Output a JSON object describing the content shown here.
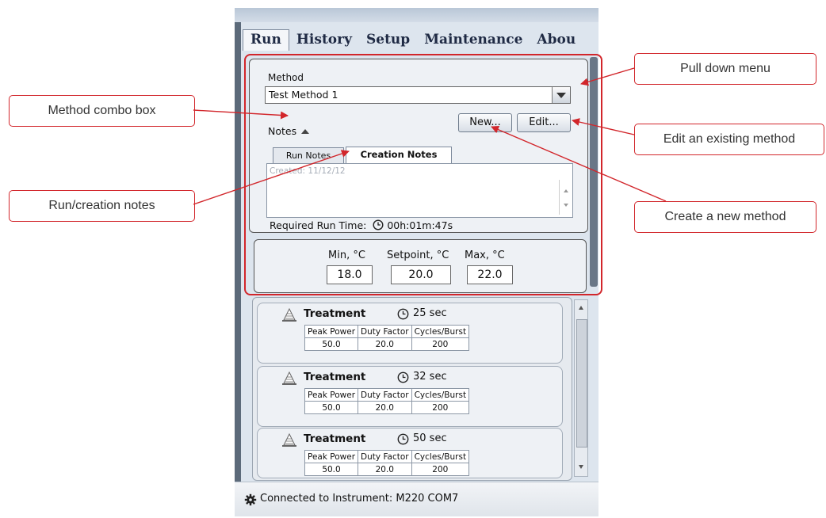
{
  "tabs": [
    {
      "label": "Run",
      "active": true
    },
    {
      "label": "History",
      "active": false
    },
    {
      "label": "Setup",
      "active": false
    },
    {
      "label": "Maintenance",
      "active": false
    },
    {
      "label": "Abou",
      "active": false
    }
  ],
  "method": {
    "label": "Method",
    "selected": "Test Method 1",
    "new_button": "New...",
    "edit_button": "Edit..."
  },
  "notes": {
    "label": "Notes",
    "tabs": [
      {
        "label": "Run Notes",
        "active": false
      },
      {
        "label": "Creation Notes",
        "active": true
      }
    ],
    "content": "Created: 11/12/12"
  },
  "run_time": {
    "label": "Required Run Time:",
    "value": "00h:01m:47s"
  },
  "temperature": {
    "min_label": "Min, °C",
    "setpoint_label": "Setpoint, °C",
    "max_label": "Max, °C",
    "min_value": "18.0",
    "setpoint_value": "20.0",
    "max_value": "22.0"
  },
  "treatments": [
    {
      "title": "Treatment",
      "duration": "25 sec",
      "headers": [
        "Peak Power",
        "Duty Factor",
        "Cycles/Burst"
      ],
      "values": [
        "50.0",
        "20.0",
        "200"
      ]
    },
    {
      "title": "Treatment",
      "duration": "32 sec",
      "headers": [
        "Peak Power",
        "Duty Factor",
        "Cycles/Burst"
      ],
      "values": [
        "50.0",
        "20.0",
        "200"
      ]
    },
    {
      "title": "Treatment",
      "duration": "50 sec",
      "headers": [
        "Peak Power",
        "Duty Factor",
        "Cycles/Burst"
      ],
      "values": [
        "50.0",
        "20.0",
        "200"
      ]
    }
  ],
  "status": {
    "text": "Connected to Instrument: M220 COM7",
    "icon": "gear-icon"
  },
  "callouts": {
    "pull_down": "Pull down menu",
    "method_combo": "Method combo box",
    "edit_existing": "Edit an existing method",
    "run_creation": "Run/creation notes",
    "create_new": "Create a new method"
  },
  "colors": {
    "callout_border": "#d2262b",
    "window_bg": "#dde5ee",
    "tab_text": "#1f2a44"
  }
}
